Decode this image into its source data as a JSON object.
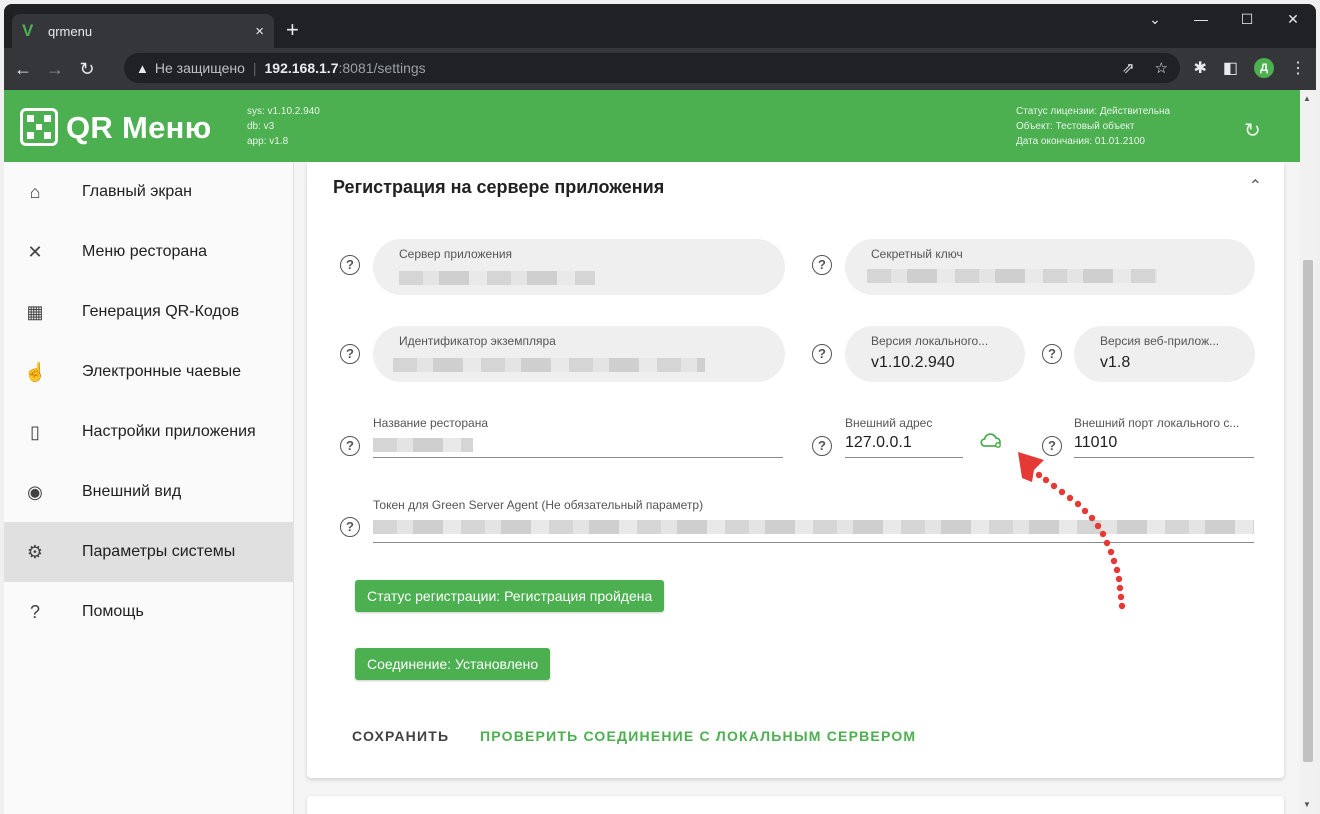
{
  "browser": {
    "tab_title": "qrmenu",
    "tab_close": "×",
    "new_tab": "+",
    "security_warning": "Не защищено",
    "url_host": "192.168.1.7",
    "url_path": ":8081/settings",
    "profile_initial": "Д"
  },
  "app": {
    "logo": "QR Меню",
    "versions": [
      "sys: v1.10.2.940",
      "db: v3",
      "app: v1.8"
    ],
    "license": [
      "Статус лицензии: Действительна",
      "Объект: Тестовый объект",
      "Дата окончания: 01.01.2100"
    ]
  },
  "sidebar": {
    "items": [
      {
        "label": "Главный экран",
        "icon": "home-icon"
      },
      {
        "label": "Меню ресторана",
        "icon": "utensils-icon"
      },
      {
        "label": "Генерация QR-Кодов",
        "icon": "qr-code-icon"
      },
      {
        "label": "Электронные чаевые",
        "icon": "tip-hand-icon"
      },
      {
        "label": "Настройки приложения",
        "icon": "app-settings-icon"
      },
      {
        "label": "Внешний вид",
        "icon": "eye-icon"
      },
      {
        "label": "Параметры системы",
        "icon": "gear-icon",
        "active": true
      },
      {
        "label": "Помощь",
        "icon": "help-icon"
      }
    ]
  },
  "section": {
    "title": "Регистрация на сервере приложения",
    "fields": {
      "app_server": {
        "label": "Сервер приложения",
        "value": ""
      },
      "secret_key": {
        "label": "Секретный ключ",
        "value": ""
      },
      "instance_id": {
        "label": "Идентификатор экземпляра",
        "value": ""
      },
      "local_version": {
        "label": "Версия локального...",
        "value": "v1.10.2.940"
      },
      "web_version": {
        "label": "Версия веб-прилож...",
        "value": "v1.8"
      },
      "restaurant_name": {
        "label": "Название ресторана",
        "value": ""
      },
      "external_address": {
        "label": "Внешний адрес",
        "value": "127.0.0.1"
      },
      "external_port": {
        "label": "Внешний порт локального с...",
        "value": "11010"
      },
      "token": {
        "label": "Токен для Green Server Agent (Не обязательный параметр)",
        "value": ""
      }
    },
    "registration_status": "Статус регистрации: Регистрация пройдена",
    "connection_status": "Соединение: Установлено",
    "save_button": "СОХРАНИТЬ",
    "check_button": "ПРОВЕРИТЬ СОЕДИНЕНИЕ С ЛОКАЛЬНЫМ СЕРВЕРОМ"
  },
  "colors": {
    "brand": "#4caf50",
    "annotation": "#e53935"
  }
}
